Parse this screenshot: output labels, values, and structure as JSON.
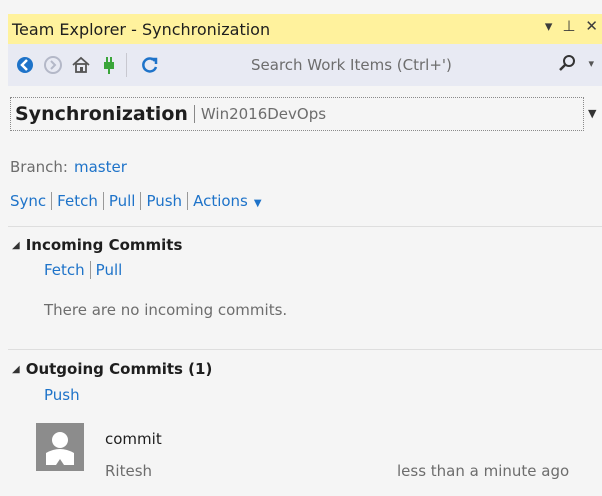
{
  "window": {
    "title": "Team Explorer - Synchronization",
    "controls": {
      "dropdown": "▾",
      "pin": "⊥",
      "close": "✕"
    }
  },
  "toolbar": {
    "search_placeholder": "Search Work Items (Ctrl+')"
  },
  "page": {
    "name": "Synchronization",
    "context": "Win2016DevOps"
  },
  "branch": {
    "label": "Branch:",
    "value": "master"
  },
  "actions": {
    "sync": "Sync",
    "fetch": "Fetch",
    "pull": "Pull",
    "push": "Push",
    "more": "Actions"
  },
  "incoming": {
    "title": "Incoming Commits",
    "fetch": "Fetch",
    "pull": "Pull",
    "message": "There are no incoming commits."
  },
  "outgoing": {
    "title": "Outgoing Commits (1)",
    "push": "Push",
    "commits": [
      {
        "message": "commit",
        "author": "Ritesh",
        "time": "less than a minute ago"
      }
    ]
  },
  "colors": {
    "title_bg": "#fff29d",
    "toolbar_bg": "#e8eaf3",
    "link": "#1e73c9"
  }
}
